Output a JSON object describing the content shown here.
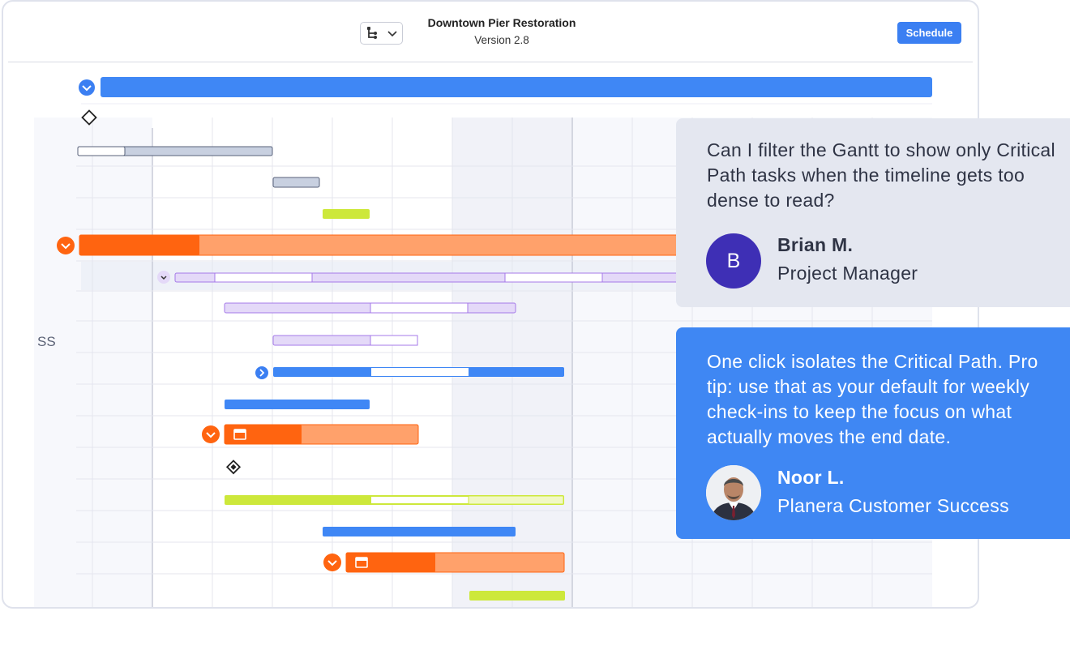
{
  "header": {
    "project_title": "Downtown Pier Restoration",
    "version": "Version 2.8",
    "schedule_label": "Schedule",
    "view_toggle_icon": "hierarchy-icon"
  },
  "chart": {
    "side_label": "SS"
  },
  "colors": {
    "accent_blue": "#3b7ff2",
    "critical_orange": "#ff6410",
    "critical_orange_light": "#ffa16b",
    "purple": "#a579e8",
    "lime": "#cde83b",
    "summary_gray": "#c8d0e0"
  },
  "question": {
    "text": "Can I filter the Gantt to show only Critical Path tasks when the timeline gets too dense to read?",
    "avatar_initial": "B",
    "author": "Brian M.",
    "role": "Project Manager"
  },
  "answer": {
    "text": "One click isolates the Critical Path. Pro tip: use that as your default for weekly check-ins to keep the focus on what actually moves the end date.",
    "author": "Noor L.",
    "role": "Planera Customer Success"
  }
}
